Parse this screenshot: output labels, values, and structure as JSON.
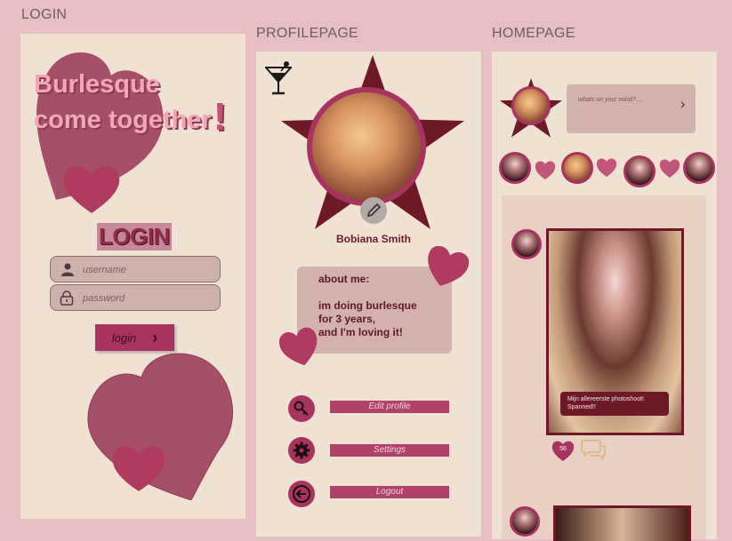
{
  "frames": {
    "login": "LOGIN",
    "profile": "PROFILEPAGE",
    "home": "HOMEPAGE"
  },
  "login": {
    "brand_line1": "Burlesque",
    "brand_line2": "come together",
    "brand_exclaim": "!",
    "heading": "LOGIN",
    "username_placeholder": "username",
    "password_placeholder": "password",
    "login_button": "login",
    "login_chevron": "›"
  },
  "profile": {
    "name": "Bobiana Smith",
    "about_title": "about me:",
    "about_line1": "im doing burlesque",
    "about_line2": "for 3 years,",
    "about_line3": "and I'm loving it!",
    "menu": [
      {
        "label": "Edit profile",
        "icon": "key-icon"
      },
      {
        "label": "Settings",
        "icon": "gear-icon"
      },
      {
        "label": "Logout",
        "icon": "logout-icon"
      }
    ]
  },
  "home": {
    "post_placeholder": "whats on your mind?....",
    "post_chevron": "›",
    "feed_caption_line1": "Mijn allereerste photoshoot!",
    "feed_caption_line2": "Spanned!!",
    "like_count": "56"
  },
  "colors": {
    "background": "#e6bfc3",
    "panel": "#f0e2d2",
    "accent": "#a8335f",
    "dark_star": "#6e1a26",
    "heart": "#a84f6c"
  }
}
